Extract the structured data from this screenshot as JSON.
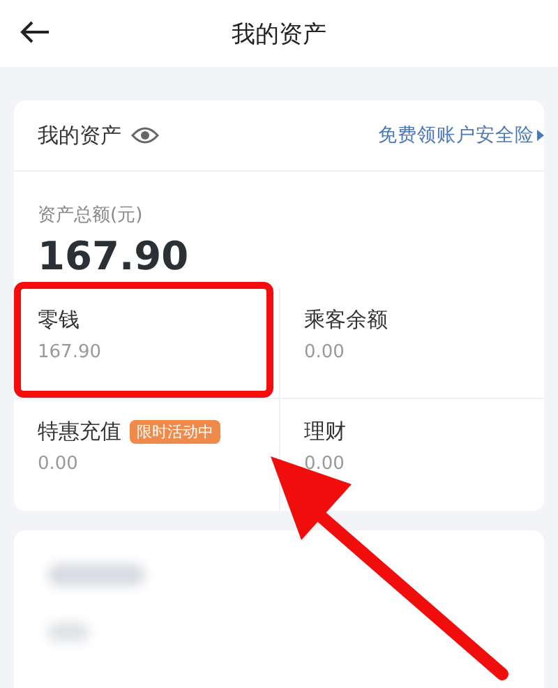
{
  "top_bar": {
    "title": "我的资产"
  },
  "assets_card": {
    "title": "我的资产",
    "insurance_link": "免费领账户安全险",
    "total_label": "资产总额(元)",
    "total": "167.90",
    "items": [
      {
        "label": "零钱",
        "value": "167.90",
        "highlighted": true
      },
      {
        "label": "乘客余额",
        "value": "0.00",
        "highlighted": false
      },
      {
        "label": "特惠充值",
        "badge": "限时活动中",
        "value": "0.00",
        "highlighted": false
      },
      {
        "label": "理财",
        "value": "0.00",
        "highlighted": false
      }
    ]
  }
}
